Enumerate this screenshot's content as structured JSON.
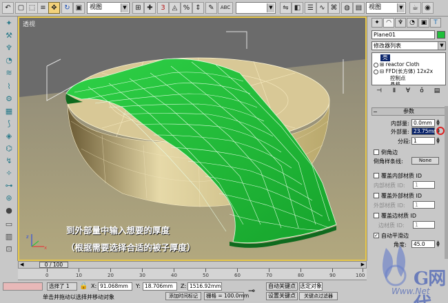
{
  "toolbar": {
    "view_select": "视图",
    "view_select2": "视图",
    "snap_label": "3",
    "abc_label": "ABC"
  },
  "viewport": {
    "label": "透视",
    "caption_line1": "到外部量中输入想要的厚度",
    "caption_line2": "（根据需要选择合适的被子厚度）",
    "colors": {
      "border": "#e8c84a",
      "cloth": "#22c23a",
      "cushion": "#c9b47a",
      "floor": "#a49a72",
      "sky": "#6a6a6a"
    }
  },
  "panel": {
    "object_name": "Plane01",
    "modifier_list": "修改器列表",
    "stack": [
      "壳",
      "reactor Cloth",
      "FFD(长方体) 12x2x",
      "控制点",
      "晶格"
    ],
    "rollout_title": "参数",
    "inner_amount_label": "内部量:",
    "inner_amount_value": "0.0mm",
    "outer_amount_label": "外部量:",
    "outer_amount_value": "23.75mm",
    "segments_label": "分段:",
    "segments_value": "1",
    "bevel_edges_label": "倒角边",
    "bevel_spline_label": "倒角样条线:",
    "none_button": "None",
    "override_inner_mat_label": "覆盖内部材质 ID",
    "inner_mat_id_label": "内部材质 ID:",
    "inner_mat_id_value": "1",
    "override_outer_mat_label": "覆盖外部材质 ID",
    "outer_mat_id_label": "外部材质 ID:",
    "outer_mat_id_value": "1",
    "override_edge_mat_label": "覆盖边材质 ID",
    "edge_mat_id_label": "边材质 ID:",
    "edge_mat_id_value": "1",
    "auto_smooth_label": "自动平滑边",
    "angle_label": "角度:",
    "angle_value": "45.0"
  },
  "timeline": {
    "frame_readout": "0 / 100",
    "ticks": [
      "0",
      "10",
      "20",
      "30",
      "40",
      "50",
      "60",
      "70",
      "80",
      "90",
      "100"
    ]
  },
  "status": {
    "selected": "选择了 1",
    "x_label": "X:",
    "x_value": "91.068mm",
    "y_label": "Y:",
    "y_value": "18.706mm",
    "z_label": "Z:",
    "z_value": "1516.92mm",
    "grid": "栅格 = 100.0mm",
    "auto_key": "自动关键点",
    "selected_object": "选定对象",
    "set_key": "设置关键点",
    "key_filters": "关键点过滤器",
    "prompt": "单击并拖动以选择并移动对象",
    "add_time_tag": "添加时间标记"
  },
  "watermark": {
    "brand": "G网代",
    "url": "Www.Net"
  }
}
